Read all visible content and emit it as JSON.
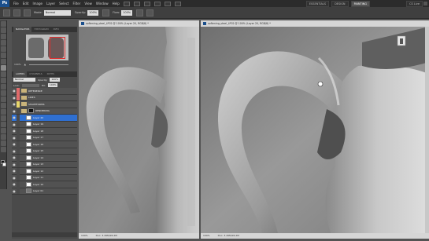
{
  "menubar": {
    "logo": "Ps",
    "items": [
      "File",
      "Edit",
      "Image",
      "Layer",
      "Select",
      "Filter",
      "View",
      "Window",
      "Help"
    ],
    "workspaces": [
      "ESSENTIALS",
      "DESIGN",
      "PAINTING"
    ],
    "active_workspace": "PAINTING",
    "cs_live": "CS Live"
  },
  "options": {
    "mode_label": "Mode:",
    "mode_value": "Normal",
    "opacity_label": "Opacity:",
    "opacity_value": "100%",
    "flow_label": "Flow:",
    "flow_value": "100%"
  },
  "navigator": {
    "tabs": [
      "NAVIGATOR",
      "HISTOGRAM",
      "INFO"
    ],
    "zoom": "100%"
  },
  "layers": {
    "tabs": [
      "LAYERS",
      "CHANNELS",
      "PATHS"
    ],
    "blend_mode": "Normal",
    "opacity_label": "Opacity:",
    "opacity_value": "100%",
    "lock_label": "Lock:",
    "fill_label": "Fill:",
    "fill_value": "100%",
    "rows": [
      {
        "name": "REFERENCE",
        "type": "folder",
        "color": "#e06a6a"
      },
      {
        "name": "LINES",
        "type": "folder",
        "color": "#e06a6a"
      },
      {
        "name": "SHAPEFORMS",
        "type": "folder",
        "color": "#e8d66a"
      },
      {
        "name": "RENDERING",
        "type": "folder",
        "color": "#4a4a4a"
      },
      {
        "name": "Layer 20",
        "type": "layer",
        "color": "#4a4a4a"
      },
      {
        "name": "Layer 19",
        "type": "layer",
        "color": "#4a4a4a"
      },
      {
        "name": "Layer 18",
        "type": "layer",
        "color": "#4a4a4a"
      },
      {
        "name": "Layer 17",
        "type": "layer",
        "color": "#4a4a4a"
      },
      {
        "name": "Layer 16",
        "type": "layer",
        "color": "#4a4a4a"
      },
      {
        "name": "Layer 15",
        "type": "layer",
        "color": "#4a4a4a"
      },
      {
        "name": "Layer 14",
        "type": "layer",
        "color": "#4a4a4a"
      },
      {
        "name": "Layer 13",
        "type": "layer",
        "color": "#4a4a4a"
      },
      {
        "name": "Layer 12",
        "type": "layer",
        "color": "#4a4a4a"
      },
      {
        "name": "Layer 11",
        "type": "layer",
        "color": "#4a4a4a"
      },
      {
        "name": "Layer 10",
        "type": "layer",
        "color": "#4a4a4a"
      },
      {
        "name": "Layer 01",
        "type": "layer",
        "color": "#4a4a4a"
      }
    ],
    "selected_index": 4
  },
  "doc_left": {
    "title": "softening_steel_LP02 @ 100% (Layer 20, RGB/8) *",
    "zoom": "100%",
    "doc_size": "Doc: 3.49M/26.2M"
  },
  "doc_right": {
    "title": "softening_steel_LP02 @ 100% (Layer 20, RGB/8) *",
    "zoom": "100%",
    "doc_size": "Doc: 3.49M/26.2M"
  }
}
